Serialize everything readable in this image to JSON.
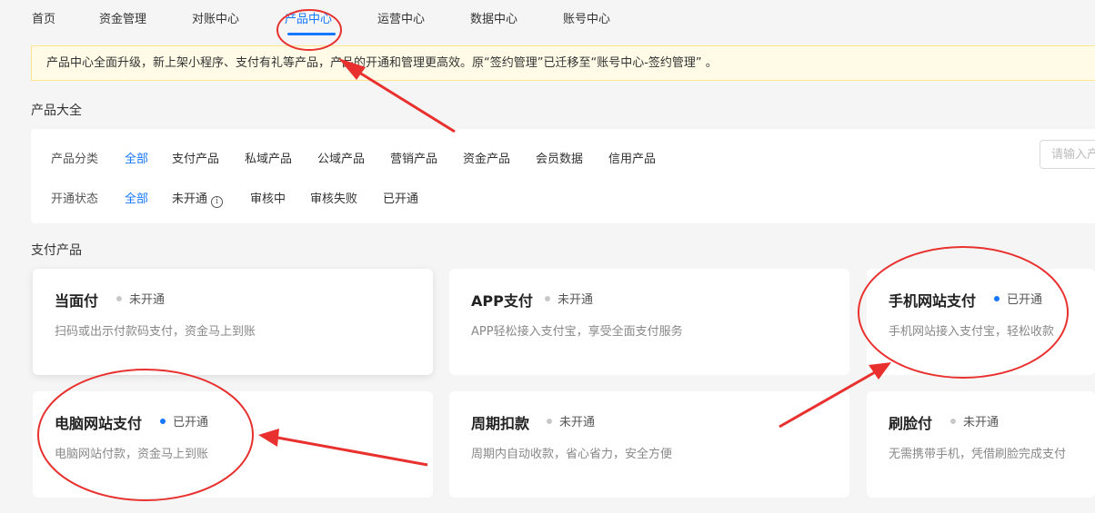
{
  "nav": {
    "items": [
      "首页",
      "资金管理",
      "对账中心",
      "产品中心",
      "运营中心",
      "数据中心",
      "账号中心"
    ],
    "active_index": 3
  },
  "notice": {
    "text": "产品中心全面升级，新上架小程序、支付有礼等产品，产品的开通和管理更高效。原“签约管理”已迁移至“账号中心-签约管理” 。"
  },
  "catalog": {
    "title": "产品大全",
    "category_label": "产品分类",
    "categories": [
      "全部",
      "支付产品",
      "私域产品",
      "公域产品",
      "营销产品",
      "资金产品",
      "会员数据",
      "信用产品"
    ],
    "status_label": "开通状态",
    "statuses": [
      "全部",
      "未开通",
      "审核中",
      "审核失败",
      "已开通"
    ],
    "search_placeholder": "请输入产品名称"
  },
  "payment_section": {
    "title": "支付产品",
    "cards": [
      {
        "title": "当面付",
        "status": "未开通",
        "desc": "扫码或出示付款码支付，资金马上到账"
      },
      {
        "title": "APP支付",
        "status": "未开通",
        "desc": "APP轻松接入支付宝，享受全面支付服务"
      },
      {
        "title": "手机网站支付",
        "status": "已开通",
        "desc": "手机网站接入支付宝，轻松收款"
      },
      {
        "title": "电脑网站支付",
        "status": "已开通",
        "desc": "电脑网站付款，资金马上到账"
      },
      {
        "title": "周期扣款",
        "status": "未开通",
        "desc": "周期内自动收款，省心省力，安全方便"
      },
      {
        "title": "刷脸付",
        "status": "未开通",
        "desc": "无需携带手机，凭借刷脸完成支付"
      }
    ]
  },
  "colors": {
    "accent": "#1677ff",
    "status_off_dot": "#c8c8c8",
    "status_on_dot": "#1677ff",
    "annotation": "#e8312f",
    "notice_bg": "#fffbe6"
  }
}
